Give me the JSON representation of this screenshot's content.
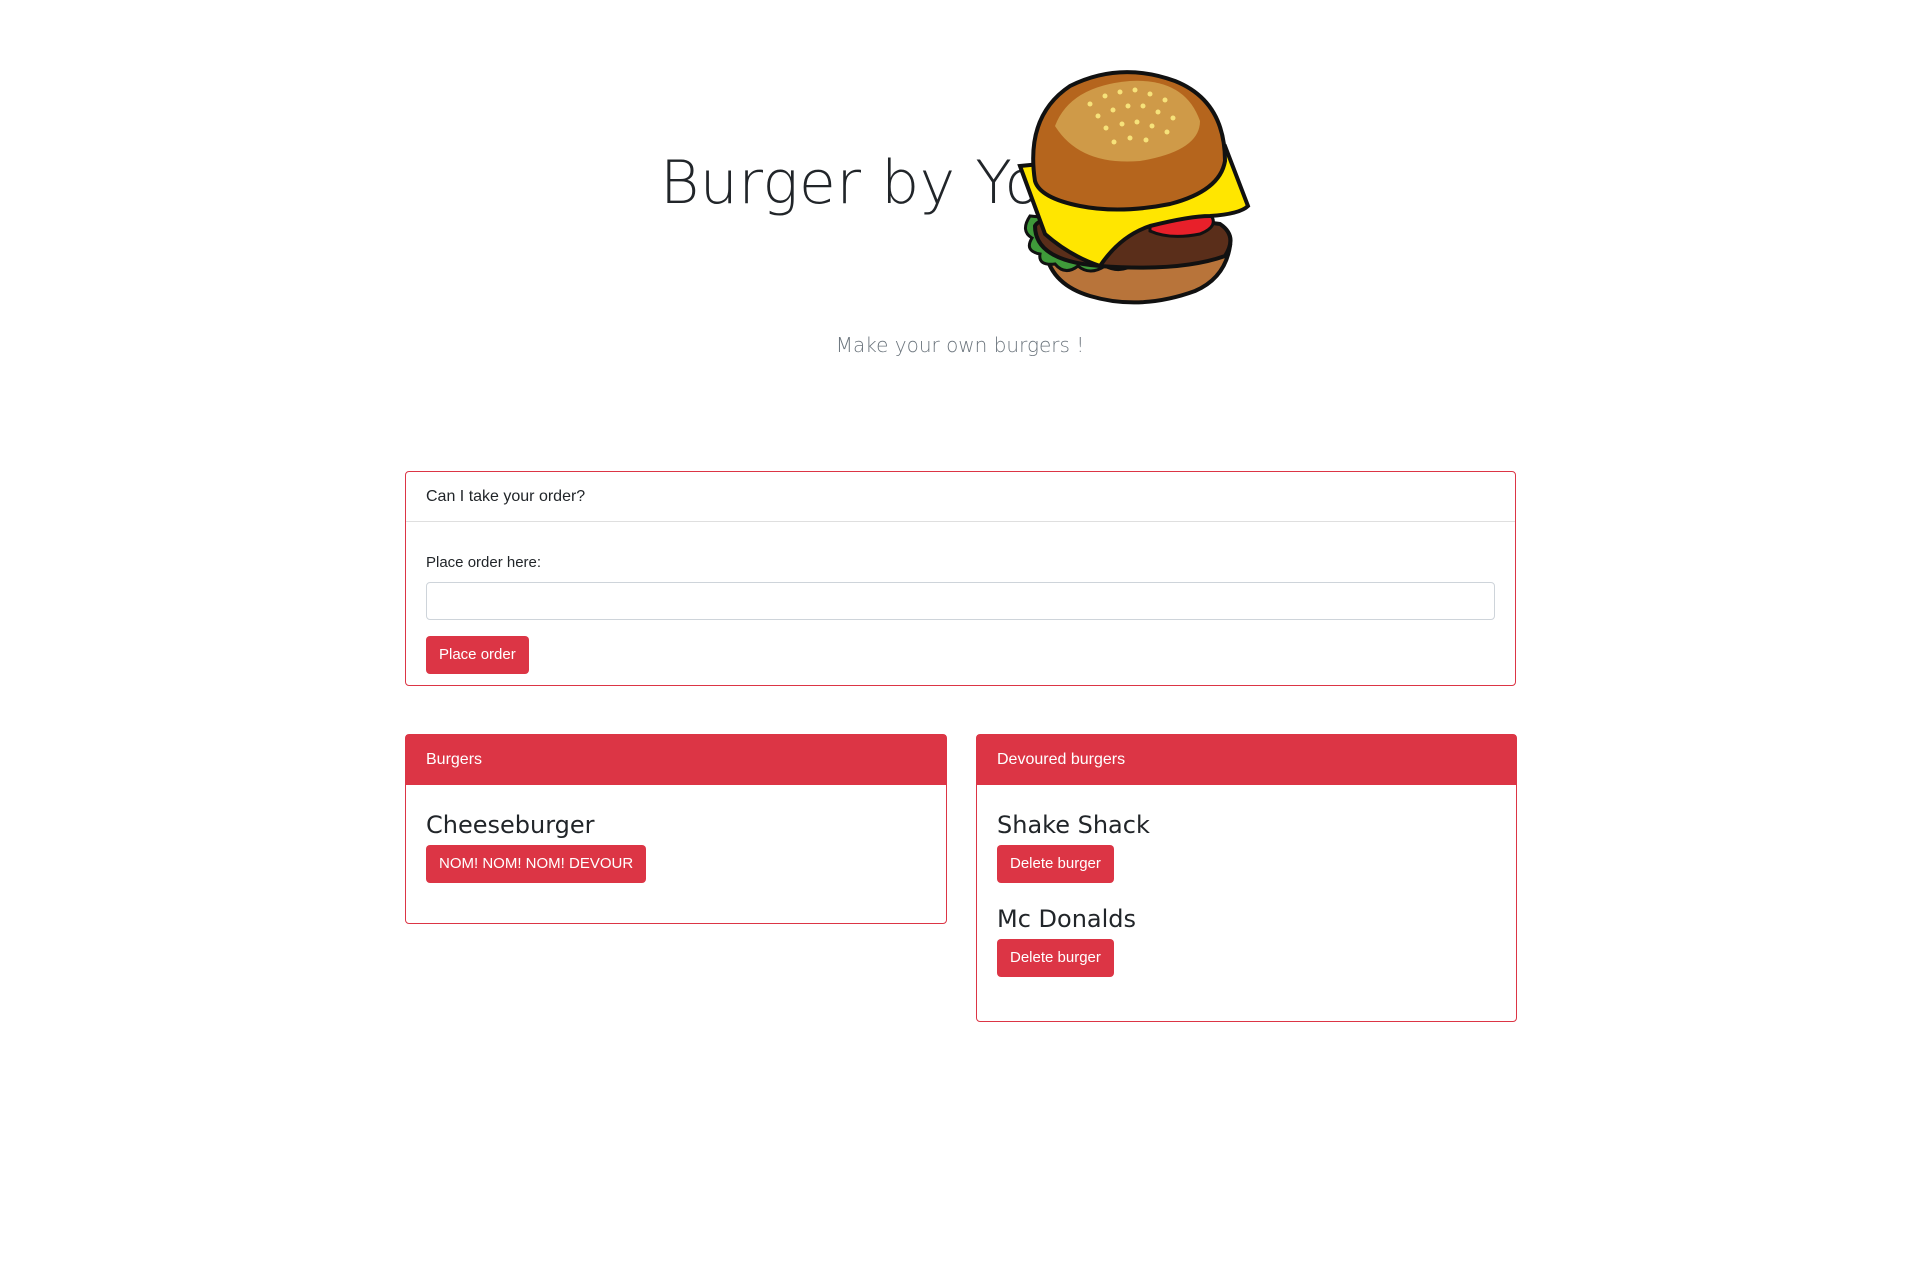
{
  "hero": {
    "title": "Burger by You",
    "subtitle": "Make your own burgers !",
    "logo_icon": "burger-icon"
  },
  "order_form": {
    "header": "Can I take your order?",
    "label": "Place order here:",
    "input_value": "",
    "input_placeholder": "",
    "submit_label": "Place order"
  },
  "burgers": {
    "header": "Burgers",
    "items": [
      {
        "name": "Cheeseburger",
        "action_label": "NOM! NOM! NOM! DEVOUR"
      }
    ]
  },
  "devoured": {
    "header": "Devoured burgers",
    "items": [
      {
        "name": "Shake Shack",
        "action_label": "Delete burger"
      },
      {
        "name": "Mc Donalds",
        "action_label": "Delete burger"
      }
    ]
  },
  "colors": {
    "accent": "#dc3545",
    "text": "#212529",
    "muted": "#6c757d"
  }
}
